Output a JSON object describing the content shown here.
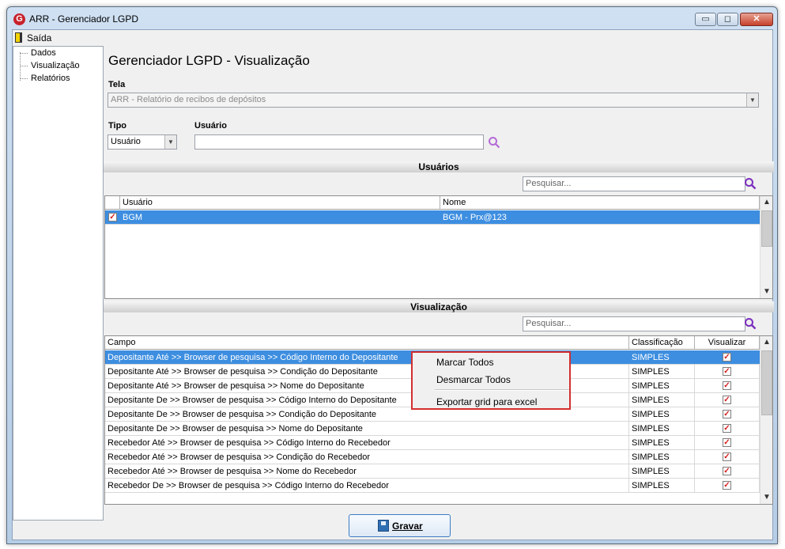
{
  "window": {
    "title": "ARR - Gerenciador LGPD"
  },
  "titlebar_buttons": {
    "minimize": "▭",
    "maximize": "◻",
    "close": "✕"
  },
  "menu": {
    "exit_label": "Saída"
  },
  "nav_tree": {
    "items": [
      "Dados",
      "Visualização",
      "Relatórios"
    ]
  },
  "page": {
    "title": "Gerenciador LGPD - Visualização"
  },
  "tela": {
    "label": "Tela",
    "value": "ARR - Relatório de recibos de depósitos"
  },
  "tipo": {
    "label": "Tipo",
    "value": "Usuário"
  },
  "usuario": {
    "label": "Usuário",
    "value": ""
  },
  "users_section": {
    "title": "Usuários",
    "search_placeholder": "Pesquisar...",
    "columns": [
      "Usuário",
      "Nome"
    ],
    "rows": [
      {
        "checked": true,
        "user": "BGM",
        "name": "BGM - Prx@123"
      }
    ]
  },
  "visual_section": {
    "title": "Visualização",
    "search_placeholder": "Pesquisar...",
    "columns": [
      "Campo",
      "Classificação",
      "Visualizar"
    ],
    "rows": [
      {
        "campo": "Depositante Até >> Browser de pesquisa >> Código Interno do Depositante",
        "classificacao": "SIMPLES",
        "visualizar": true
      },
      {
        "campo": "Depositante Até >> Browser de pesquisa >> Condição do Depositante",
        "classificacao": "SIMPLES",
        "visualizar": true
      },
      {
        "campo": "Depositante Até >> Browser de pesquisa >> Nome do Depositante",
        "classificacao": "SIMPLES",
        "visualizar": true
      },
      {
        "campo": "Depositante De >> Browser de pesquisa >> Código Interno do Depositante",
        "classificacao": "SIMPLES",
        "visualizar": true
      },
      {
        "campo": "Depositante De >> Browser de pesquisa >> Condição do Depositante",
        "classificacao": "SIMPLES",
        "visualizar": true
      },
      {
        "campo": "Depositante De >> Browser de pesquisa >> Nome do Depositante",
        "classificacao": "SIMPLES",
        "visualizar": true
      },
      {
        "campo": "Recebedor Até >> Browser de pesquisa >> Código Interno do Recebedor",
        "classificacao": "SIMPLES",
        "visualizar": true
      },
      {
        "campo": "Recebedor Até >> Browser de pesquisa >> Condição do Recebedor",
        "classificacao": "SIMPLES",
        "visualizar": true
      },
      {
        "campo": "Recebedor Até >> Browser de pesquisa >> Nome do Recebedor",
        "classificacao": "SIMPLES",
        "visualizar": true
      },
      {
        "campo": "Recebedor De >> Browser de pesquisa >> Código Interno do Recebedor",
        "classificacao": "SIMPLES",
        "visualizar": true
      }
    ]
  },
  "context_menu": {
    "items": [
      "Marcar Todos",
      "Desmarcar Todos",
      "Exportar grid para excel"
    ]
  },
  "footer": {
    "save_label": "Gravar"
  },
  "colors": {
    "selection": "#3d8ee0",
    "highlight_border": "#d32f2f",
    "search_icon": "#7b2fbe"
  }
}
